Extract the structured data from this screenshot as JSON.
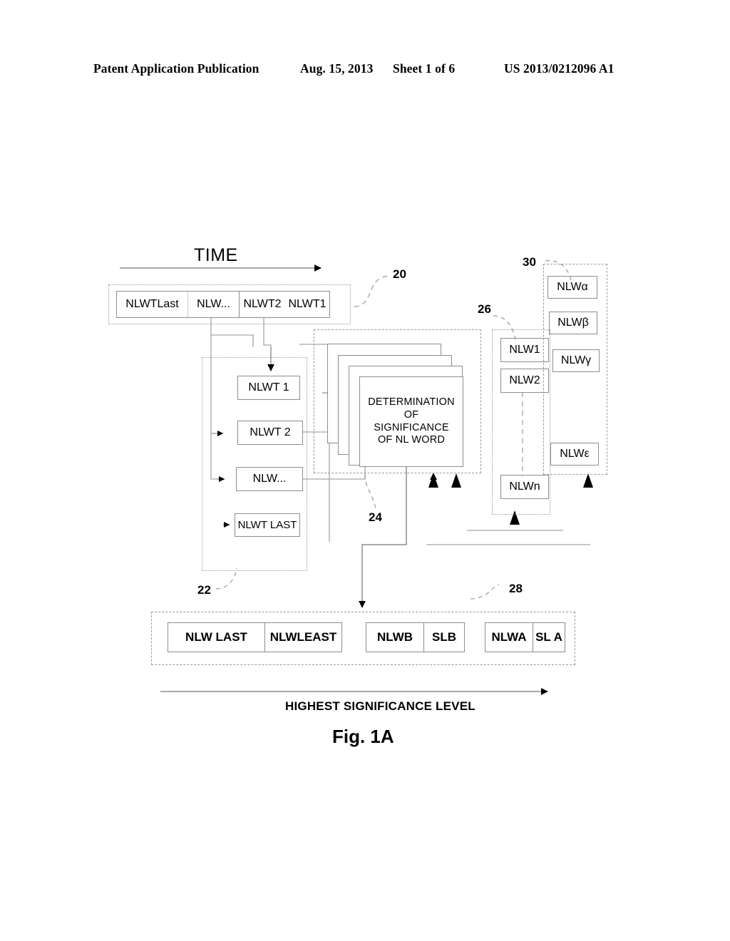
{
  "header": {
    "publication": "Patent Application Publication",
    "date": "Aug. 15, 2013",
    "sheet": "Sheet 1 of 6",
    "number": "US 2013/0212096 A1"
  },
  "figure": {
    "time_axis_label": "TIME",
    "significance_axis_label": "HIGHEST SIGNIFICANCE LEVEL",
    "caption": "Fig. 1A",
    "ref_numerals": {
      "stream": "20",
      "token_group": "22",
      "determination": "24",
      "word_group": "26",
      "output_row": "28",
      "significance_group": "30"
    },
    "timeline_cells": [
      {
        "label": "NLWTLast"
      },
      {
        "label": "NLW..."
      },
      {
        "label": "NLWT2"
      },
      {
        "label": "NLWT1"
      }
    ],
    "token_boxes": [
      {
        "label": "NLWT 1"
      },
      {
        "label": "NLWT 2"
      },
      {
        "label": "NLW..."
      },
      {
        "label": "NLWT LAST"
      }
    ],
    "determination_box": {
      "line1": "DETERMINATION",
      "line2": "OF",
      "line3": "SIGNIFICANCE",
      "line4": "OF NL WORD"
    },
    "word_boxes": [
      {
        "label": "NLW1"
      },
      {
        "label": "NLW2"
      },
      {
        "label": "NLWn"
      }
    ],
    "significance_boxes": [
      {
        "label": "NLWα"
      },
      {
        "label": "NLWβ"
      },
      {
        "label": "NLWγ"
      },
      {
        "label": "NLWε"
      }
    ],
    "output_groups": [
      {
        "cells": [
          {
            "label": "NLW LAST"
          },
          {
            "label": "NLWLEAST"
          }
        ]
      },
      {
        "cells": [
          {
            "label": "NLWB"
          },
          {
            "label": "SLB"
          }
        ]
      },
      {
        "cells": [
          {
            "label": "NLWA"
          },
          {
            "label": "SL A"
          }
        ]
      }
    ]
  },
  "colors": {
    "ink": "#000000",
    "line": "#8d8d8d",
    "dashed": "#9a9a9a",
    "paper": "#ffffff"
  }
}
